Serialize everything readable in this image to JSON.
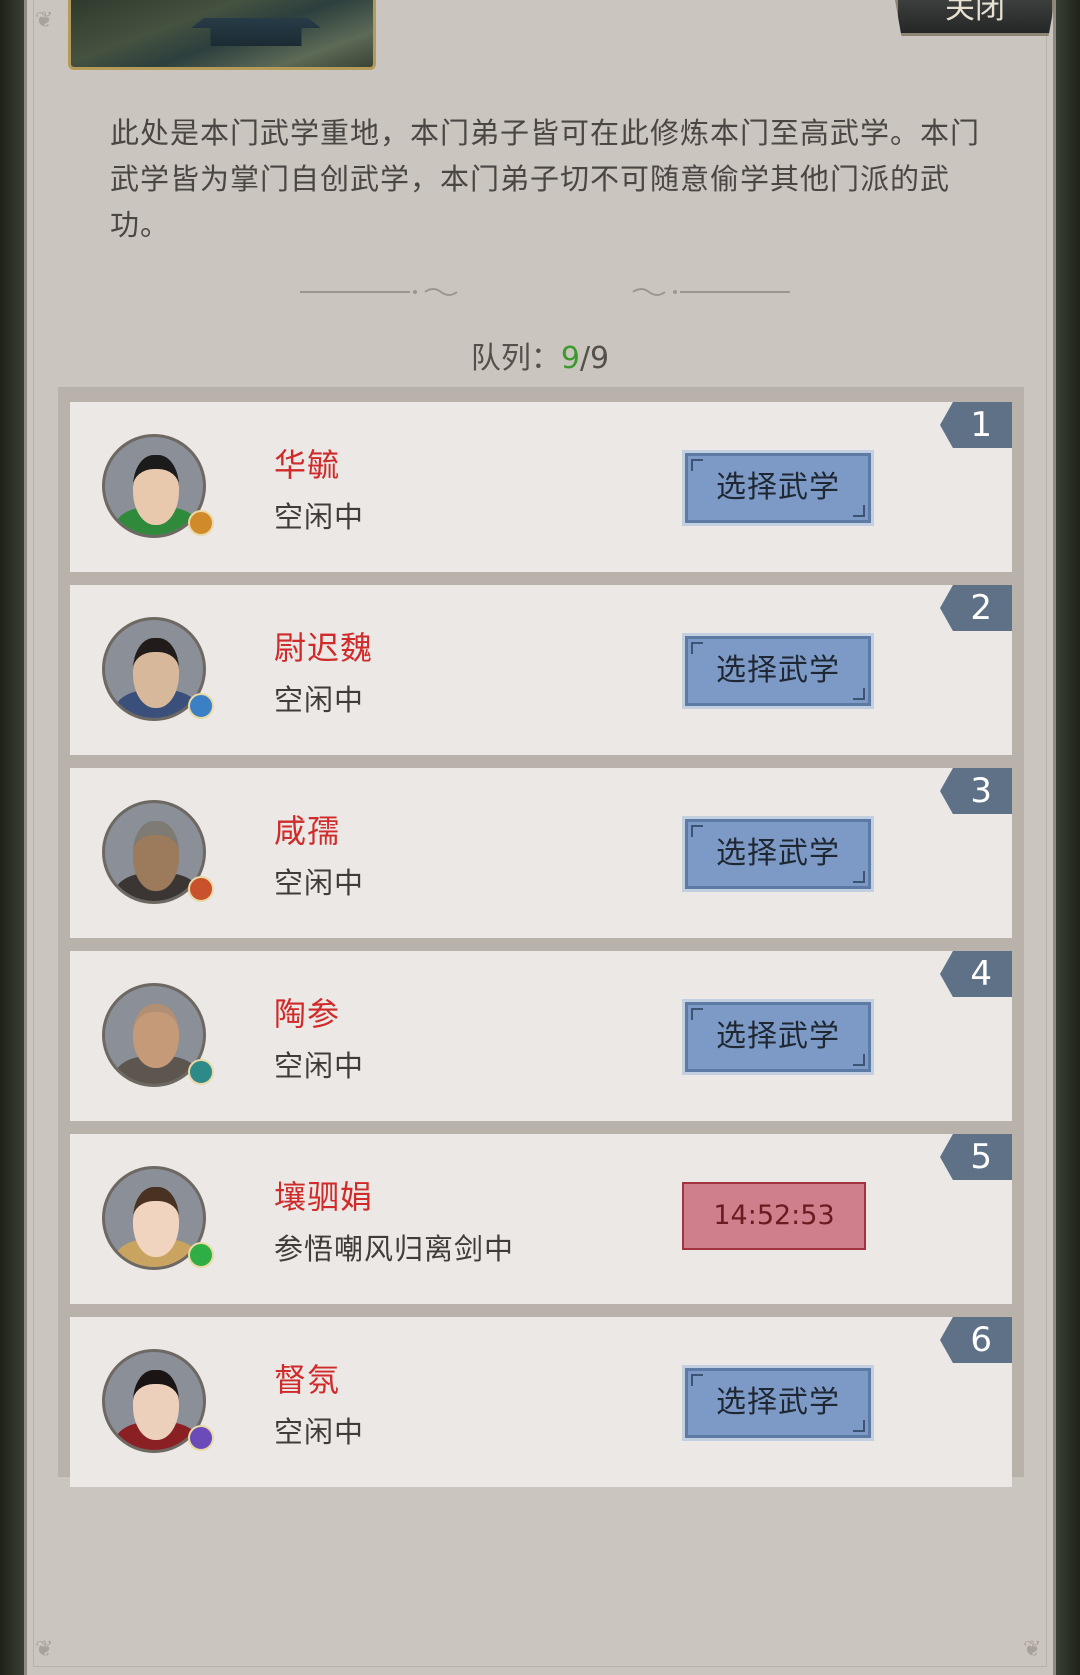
{
  "header": {
    "close_label": "关闭"
  },
  "description": "此处是本门武学重地，本门弟子皆可在此修炼本门至高武学。本门武学皆为掌门自创武学，本门弟子切不可随意偷学其他门派的武功。",
  "queue": {
    "label": "队列：",
    "current": "9",
    "separator": "/",
    "total": "9"
  },
  "disciples": [
    {
      "index": "1",
      "name": "华毓",
      "status": "空闲中",
      "action": "选择武学",
      "skin": "#e8c9ad",
      "outfit": "#2f8a3c",
      "hair": "#1b1b1b",
      "badge": "#d08a2a"
    },
    {
      "index": "2",
      "name": "尉迟魏",
      "status": "空闲中",
      "action": "选择武学",
      "skin": "#d8b89a",
      "outfit": "#3a4f7a",
      "hair": "#211c19",
      "badge": "#3b7fc4"
    },
    {
      "index": "3",
      "name": "咸孺",
      "status": "空闲中",
      "action": "选择武学",
      "skin": "#9c7b5c",
      "outfit": "#3b3633",
      "hair": "#7d7b73",
      "badge": "#c9522c"
    },
    {
      "index": "4",
      "name": "陶参",
      "status": "空闲中",
      "action": "选择武学",
      "skin": "#c49a78",
      "outfit": "#5c564f",
      "hair": "#b08f74",
      "badge": "#2e8a88"
    },
    {
      "index": "5",
      "name": "壤驷娟",
      "status": "参悟嘲风归离剑中",
      "action": "14:52:53",
      "skin": "#f0d4bf",
      "outfit": "#c9a460",
      "hair": "#4a3222",
      "badge": "#2fae46"
    },
    {
      "index": "6",
      "name": "督氛",
      "status": "空闲中",
      "action": "选择武学",
      "skin": "#ecd0bb",
      "outfit": "#8a1f24",
      "hair": "#1a1414",
      "badge": "#6b4bb8"
    }
  ]
}
